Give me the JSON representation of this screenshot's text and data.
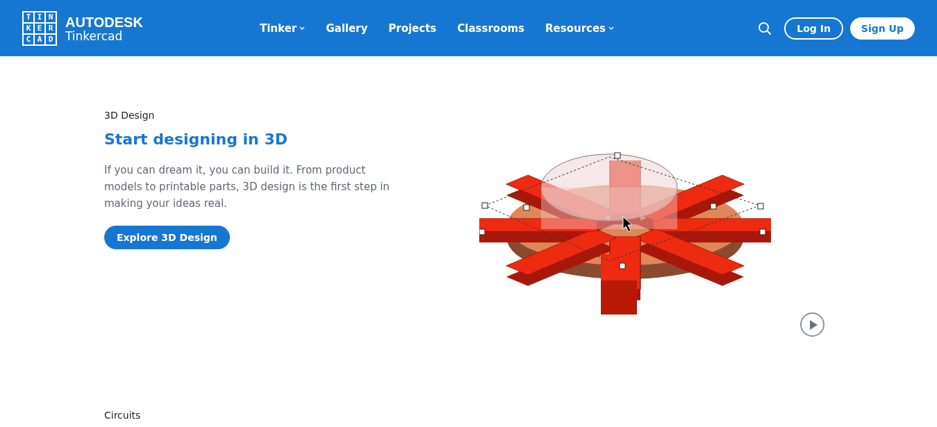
{
  "header": {
    "logo_tiles": [
      "T",
      "I",
      "N",
      "K",
      "E",
      "R",
      "C",
      "A",
      "D"
    ],
    "brand": "AUTODESK",
    "product": "Tinkercad",
    "nav": [
      {
        "label": "Tinker",
        "has_dropdown": true
      },
      {
        "label": "Gallery",
        "has_dropdown": false
      },
      {
        "label": "Projects",
        "has_dropdown": false
      },
      {
        "label": "Classrooms",
        "has_dropdown": false
      },
      {
        "label": "Resources",
        "has_dropdown": true
      }
    ],
    "login": "Log In",
    "signup": "Sign Up"
  },
  "section": {
    "eyebrow": "3D Design",
    "title": "Start designing in 3D",
    "body": "If you can dream it, you can build it. From product models to printable parts, 3D design is the first step in making your ideas real.",
    "button": "Explore 3D Design"
  },
  "next_section": {
    "eyebrow": "Circuits"
  }
}
